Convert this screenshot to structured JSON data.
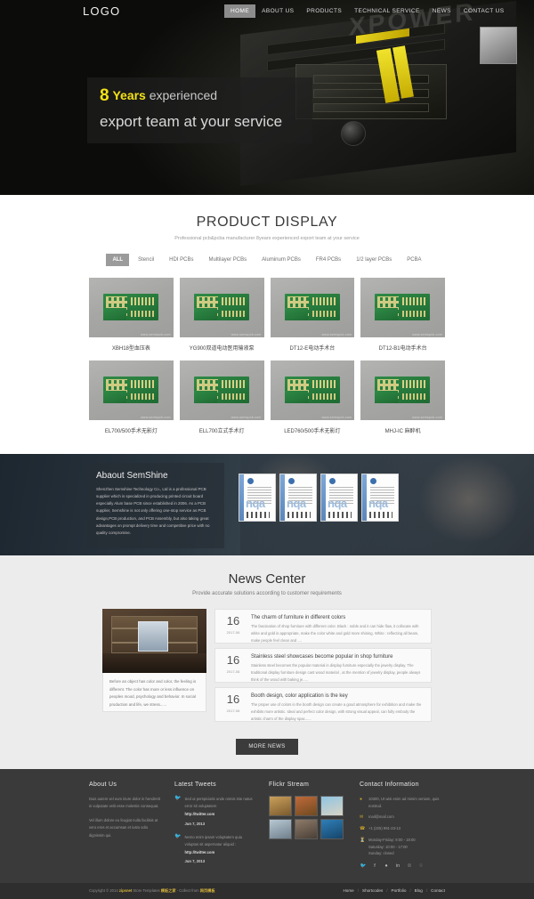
{
  "header": {
    "logo": "LOGO",
    "nav": [
      {
        "label": "HOME",
        "active": true
      },
      {
        "label": "ABOUT US",
        "active": false
      },
      {
        "label": "PRODUCTS",
        "active": false
      },
      {
        "label": "TECHNICAL SERVICE",
        "active": false
      },
      {
        "label": "NEWS",
        "active": false
      },
      {
        "label": "CONTACT US",
        "active": false
      }
    ]
  },
  "hero": {
    "number": "8",
    "years": "Years",
    "line1_rest": "experienced",
    "line2": "export team at your service",
    "bg_word": "XPOWER",
    "accent_color": "#f3e215"
  },
  "products": {
    "title": "PRODUCT DISPLAY",
    "subtitle": "Professional pcb&pcba manufacturer 8years experienced export team at your service",
    "filters": [
      {
        "label": "ALL",
        "active": true
      },
      {
        "label": "Stencil",
        "active": false
      },
      {
        "label": "HDI PCBs",
        "active": false
      },
      {
        "label": "Multilayer PCBs",
        "active": false
      },
      {
        "label": "Aluminum PCBs",
        "active": false
      },
      {
        "label": "FR4 PCBs",
        "active": false
      },
      {
        "label": "1/2 layer PCBs",
        "active": false
      },
      {
        "label": "PCBA",
        "active": false
      }
    ],
    "watermark": "www.semspcb.com",
    "items": [
      {
        "caption": "XBH18型血压表"
      },
      {
        "caption": "YG900双道电动医用输液泵"
      },
      {
        "caption": "DT12-E电动手术台"
      },
      {
        "caption": "DT12-B1电动手术台"
      },
      {
        "caption": "EL700/500手术无影灯"
      },
      {
        "caption": "ELL700立式手术灯"
      },
      {
        "caption": "LED760/500手术无影灯"
      },
      {
        "caption": "MHJ-IC 麻醉机"
      }
    ]
  },
  "about": {
    "heading": "Abaout SemShine",
    "body": "Shenzhen Semshine Technology Co., Ltd is a professional PCB supplier which is specialized in producing printed circuit board especially Alum base PCB since established in 2006. As a PCB supplier, Semshine is not only offering one-stop service as PCB design,PCB production, and PCB Assembly, but also taking great advantages on prompt delivery time and competitive price with no quality compromise.",
    "certificate_label": "nqa"
  },
  "news": {
    "title": "News Center",
    "subtitle": "Provide accurate solutions according to customer requirements",
    "feature_caption": "Before an object has color and color, the feeling is different. The color has more or less influence on peoples mood, psychology and behavior. In social production and life, we stress......",
    "items": [
      {
        "day": "16",
        "month": "2017-06",
        "title": "The charm of furniture in different colors",
        "excerpt": "The fascination of shop furniture with different color. Black : noble and it can hide flaw, it collocate with white and gold is appropriate, make the color white and gold more shining. White : reflecting all beam, make people feel clean and ...."
      },
      {
        "day": "16",
        "month": "2017-06",
        "title": "Stainless steel showcases become popular in shop furniture",
        "excerpt": "Stainless steel becomes the popular material in display furniture especially the jewelry display. The traditional display furniture design cant wood material , at the mention of jewelry display, people always think of the wood with baking je....."
      },
      {
        "day": "16",
        "month": "2017-06",
        "title": "Booth design, color application is the key",
        "excerpt": "The proper use of colors in the booth design can create a good atmosphere for exhibition and make the exhibits more artistic. Ideal and perfect color design, with strong visual appeal, can fully embody the artistic charm of the display spac......"
      }
    ],
    "more_button": "MORE NEWS"
  },
  "footer": {
    "about": {
      "heading": "About Us",
      "paragraph1": "Duis autem vel eum iriure dolor in hendrerit in vulputate velit esse molestie consequat.",
      "paragraph2": "Vel illum dolore eu feugiat nulla facilisis at vero eros et accumsan et iusto odio dignissim qui."
    },
    "tweets": {
      "heading": "Latest Tweets",
      "items": [
        {
          "icon": "twitter-icon",
          "text": "Sed ut perspiciatis unde omnis iste natus error sit voluptatem",
          "link": "http://twitter.com",
          "date": "Jun 7, 2013"
        },
        {
          "icon": "twitter-icon",
          "text": "Nemo enim ipsam voluptatem quia voluptas sit aspernatur aliquid :",
          "link": "http://twitter.com",
          "date": "Jun 7, 2013"
        }
      ]
    },
    "flickr": {
      "heading": "Flickr Stream"
    },
    "contact": {
      "heading": "Contact Information",
      "address": "10300, Ut wisi enim ad minim veniam, quis nostrud.",
      "email": "mail@mail.com",
      "phone": "+1 (225) 991-23-13",
      "hours_1": "Monday-Friday: 9:00 - 18:00",
      "hours_2": "Saturday: 10:00 - 17:00",
      "hours_3": "Sunday: closed",
      "icons": {
        "address": "map-pin-icon",
        "email": "envelope-icon",
        "phone": "phone-icon",
        "hours": "clock-icon"
      },
      "socials": [
        "twitter-icon",
        "facebook-icon",
        "flickr-icon",
        "linkedin-icon",
        "google-plus-icon",
        "rss-icon"
      ]
    }
  },
  "copyright": {
    "text_prefix": "Copyright © 2014 ",
    "brand": "zipsnet",
    "text_mid": " Store Templates ",
    "highlight": "模板之家",
    "text_suffix": " - Collect from ",
    "tail": "网页模板",
    "links": [
      "Home",
      "Shortcodes",
      "Portfolio",
      "Blog",
      "Contact"
    ],
    "separator": "/"
  }
}
